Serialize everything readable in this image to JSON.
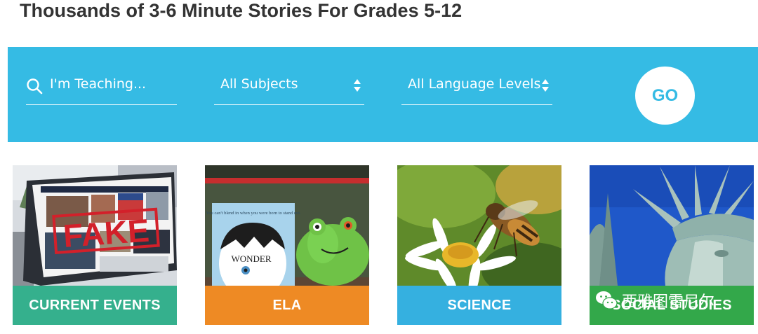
{
  "page": {
    "title": "Thousands of 3-6 Minute Stories For Grades 5-12"
  },
  "search": {
    "teaching_placeholder": "I'm Teaching...",
    "subject_selected": "All Subjects",
    "level_selected": "All Language Levels",
    "go_label": "GO"
  },
  "categories": [
    {
      "label": "CURRENT EVENTS",
      "color": "#35b08d",
      "icon": "fake-news-laptop-image"
    },
    {
      "label": "ELA",
      "color": "#ee8a24",
      "icon": "wonder-book-frog-image"
    },
    {
      "label": "SCIENCE",
      "color": "#35b0e0",
      "icon": "bee-flower-image"
    },
    {
      "label": "SOCIAL STUDIES",
      "color": "#33a84a",
      "icon": "statue-of-liberty-image"
    }
  ],
  "images": {
    "fake_stamp": "FAKE",
    "book_quote": "You can't blend in when you were born to stand out.",
    "book_title": "WONDER"
  },
  "watermark": {
    "text": "西雅图雷尼尔",
    "icon": "wechat-icon"
  },
  "colors": {
    "banner": "#35bbe4",
    "title": "#333333"
  }
}
